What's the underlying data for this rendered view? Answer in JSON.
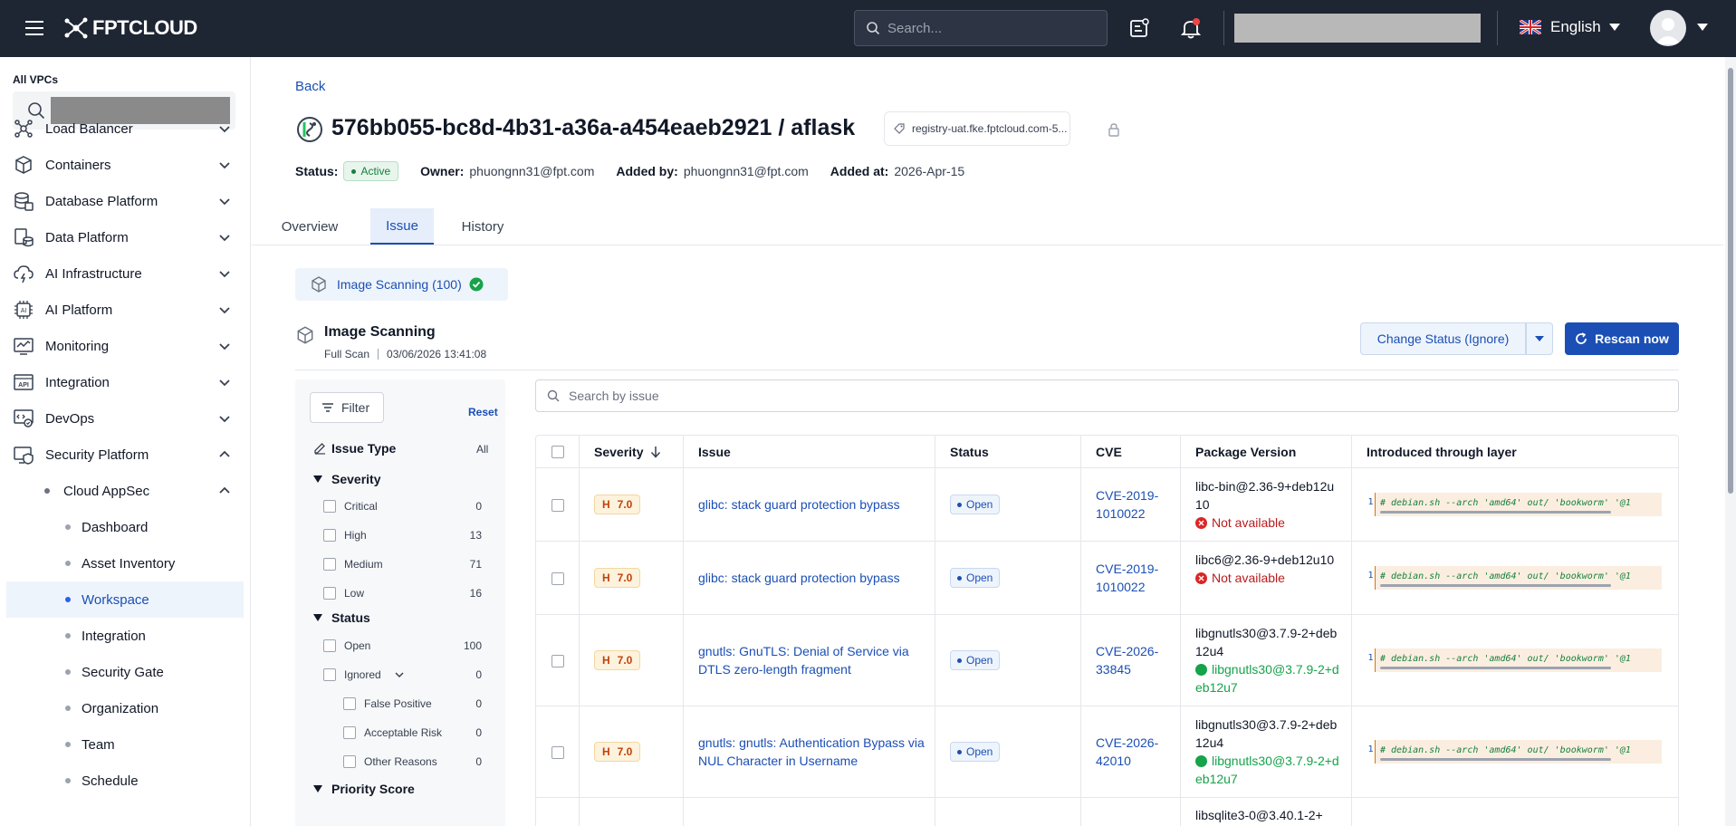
{
  "header": {
    "logo_text": "FPTCLOUD",
    "search_placeholder": "Search...",
    "language": "English"
  },
  "sidebar": {
    "vpcs_label": "All VPCs",
    "items": [
      {
        "label": "Load Balancer",
        "icon": "load-balancer-icon"
      },
      {
        "label": "Containers",
        "icon": "containers-icon"
      },
      {
        "label": "Database Platform",
        "icon": "database-icon"
      },
      {
        "label": "Data Platform",
        "icon": "data-platform-icon"
      },
      {
        "label": "AI Infrastructure",
        "icon": "ai-infrastructure-icon"
      },
      {
        "label": "AI Platform",
        "icon": "ai-platform-icon"
      },
      {
        "label": "Monitoring",
        "icon": "monitoring-icon"
      },
      {
        "label": "Integration",
        "icon": "api-icon"
      },
      {
        "label": "DevOps",
        "icon": "devops-icon"
      },
      {
        "label": "Security Platform",
        "icon": "security-icon"
      }
    ],
    "sub_group": "Cloud AppSec",
    "sub_items": [
      "Dashboard",
      "Asset Inventory",
      "Workspace",
      "Integration",
      "Security Gate",
      "Organization",
      "Team",
      "Schedule"
    ],
    "active_sub_item": "Workspace"
  },
  "page": {
    "back": "Back",
    "title": "576bb055-bc8d-4b31-a36a-a454eaeb2921 / aflask",
    "registry": "registry-uat.fke.fptcloud.com-5...",
    "status_label": "Status:",
    "status_value": "Active",
    "owner_label": "Owner:",
    "owner_value": "phuongnn31@fpt.com",
    "added_by_label": "Added by:",
    "added_by_value": "phuongnn31@fpt.com",
    "added_at_label": "Added at:",
    "added_at_value": "2026-Apr-15",
    "tabs": [
      "Overview",
      "Issue",
      "History"
    ],
    "active_tab": "Issue",
    "scan_chip": "Image Scanning (100)",
    "section_title": "Image Scanning",
    "scan_type": "Full Scan",
    "scan_time": "03/06/2026 13:41:08",
    "btn_change_status": "Change Status (Ignore)",
    "btn_rescan": "Rescan now"
  },
  "filters": {
    "filter_button": "Filter",
    "reset": "Reset",
    "issue_type_label": "Issue Type",
    "issue_type_value": "All",
    "severity_label": "Severity",
    "severity": [
      {
        "label": "Critical",
        "count": "0"
      },
      {
        "label": "High",
        "count": "13"
      },
      {
        "label": "Medium",
        "count": "71"
      },
      {
        "label": "Low",
        "count": "16"
      }
    ],
    "status_label": "Status",
    "status": [
      {
        "label": "Open",
        "count": "100"
      },
      {
        "label": "Ignored",
        "count": "0"
      }
    ],
    "ignored_reasons": [
      {
        "label": "False Positive",
        "count": "0"
      },
      {
        "label": "Acceptable Risk",
        "count": "0"
      },
      {
        "label": "Other Reasons",
        "count": "0"
      }
    ],
    "next_group": "Priority Score"
  },
  "table": {
    "search_placeholder": "Search by issue",
    "columns": [
      "Severity",
      "Issue",
      "Status",
      "CVE",
      "Package Version",
      "Introduced through layer"
    ],
    "rows": [
      {
        "sev_letter": "H",
        "score": "7.0",
        "issue": "glibc: stack guard protection bypass",
        "status": "Open",
        "cve": "CVE-2019-1010022",
        "package": "libc-bin@2.36-9+deb12u10",
        "fix": "Not available",
        "fix_available": false,
        "layer_no": "1",
        "layer": "# debian.sh --arch 'amd64' out/ 'bookworm' '@1"
      },
      {
        "sev_letter": "H",
        "score": "7.0",
        "issue": "glibc: stack guard protection bypass",
        "status": "Open",
        "cve": "CVE-2019-1010022",
        "package": "libc6@2.36-9+deb12u10",
        "fix": "Not available",
        "fix_available": false,
        "layer_no": "1",
        "layer": "# debian.sh --arch 'amd64' out/ 'bookworm' '@1"
      },
      {
        "sev_letter": "H",
        "score": "7.0",
        "issue": "gnutls: GnuTLS: Denial of Service via DTLS zero-length fragment",
        "status": "Open",
        "cve": "CVE-2026-33845",
        "package": "libgnutls30@3.7.9-2+deb12u4",
        "fix": "libgnutls30@3.7.9-2+deb12u7",
        "fix_available": true,
        "layer_no": "1",
        "layer": "# debian.sh --arch 'amd64' out/ 'bookworm' '@1"
      },
      {
        "sev_letter": "H",
        "score": "7.0",
        "issue": "gnutls: gnutls: Authentication Bypass via NUL Character in Username",
        "status": "Open",
        "cve": "CVE-2026-42010",
        "package": "libgnutls30@3.7.9-2+deb12u4",
        "fix": "libgnutls30@3.7.9-2+deb12u7",
        "fix_available": true,
        "layer_no": "1",
        "layer": "# debian.sh --arch 'amd64' out/ 'bookworm' '@1"
      },
      {
        "sev_letter": "",
        "score": "",
        "issue": "",
        "status": "",
        "cve": "",
        "package": "libsqlite3-0@3.40.1-2+",
        "fix": "",
        "fix_available": false,
        "layer_no": "",
        "layer": ""
      }
    ]
  }
}
